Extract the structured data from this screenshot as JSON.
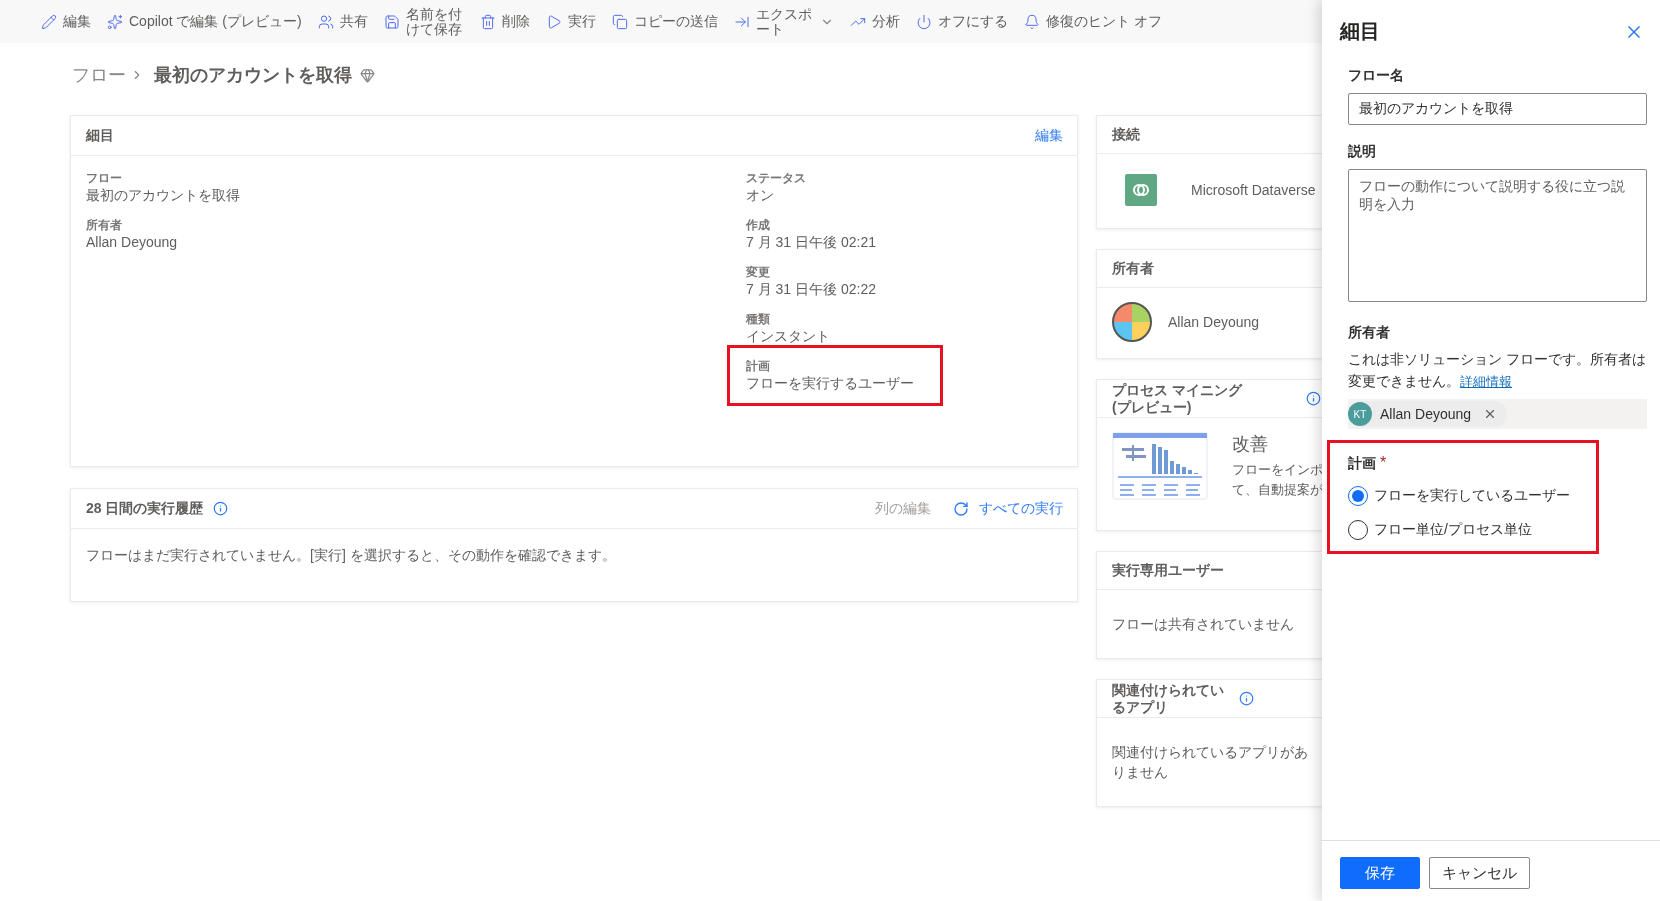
{
  "toolbar": [
    {
      "kind": "edit",
      "label": "編集"
    },
    {
      "kind": "copilot",
      "label": "Copilot で編集 (プレビュー)"
    },
    {
      "kind": "share",
      "label": "共有"
    },
    {
      "kind": "save-as",
      "label": "名前を付けて保存"
    },
    {
      "kind": "delete",
      "label": "削除"
    },
    {
      "kind": "run",
      "label": "実行"
    },
    {
      "kind": "copy",
      "label": "コピーの送信"
    },
    {
      "kind": "export",
      "label": "エクスポート",
      "menu": true
    },
    {
      "kind": "analytics",
      "label": "分析"
    },
    {
      "kind": "power",
      "label": "オフにする"
    },
    {
      "kind": "bell",
      "label": "修復のヒント オフ"
    }
  ],
  "breadcrumb": {
    "parent": "フロー",
    "current": "最初のアカウントを取得"
  },
  "details_card": {
    "title": "細目",
    "edit_link": "編集",
    "left_fields": [
      {
        "label": "フロー",
        "value": "最初のアカウントを取得",
        "highlighted": false
      },
      {
        "label": "所有者",
        "value": "Allan Deyoung",
        "highlighted": false
      }
    ],
    "right_fields": [
      {
        "label": "ステータス",
        "value": "オン",
        "highlighted": false
      },
      {
        "label": "作成",
        "value": "7 月 31 日午後 02:21",
        "highlighted": false
      },
      {
        "label": "変更",
        "value": "7 月 31 日午後 02:22",
        "highlighted": false
      },
      {
        "label": "種類",
        "value": "インスタント",
        "highlighted": false
      },
      {
        "label": "計画",
        "value": "フローを実行するユーザー",
        "highlighted": true
      }
    ]
  },
  "run_history": {
    "title": "28 日間の実行履歴",
    "edit_columns": "列の編集",
    "all_runs": "すべての実行",
    "message": "フローはまだ実行されていません。[実行] を選択すると、その動作を確認できます。"
  },
  "side_cards": [
    {
      "kind": "connection",
      "title": "接続",
      "name": "Microsoft Dataverse"
    },
    {
      "kind": "owner",
      "title": "所有者",
      "name": "Allan Deyoung"
    },
    {
      "kind": "mining",
      "title": "プロセス マイニング (プレビュー)",
      "heading": "改善",
      "lines": [
        "フローをインポ",
        "て、自動提案が"
      ]
    },
    {
      "kind": "message",
      "title": "実行専用ユーザー",
      "message": "フローは共有されていません"
    },
    {
      "kind": "message",
      "title": "関連付けられているアプリ",
      "info": true,
      "message": "関連付けられているアプリがありません"
    }
  ],
  "panel": {
    "title": "細目",
    "flow_name": {
      "label": "フロー名",
      "value": "最初のアカウントを取得"
    },
    "description": {
      "label": "説明",
      "placeholder": "フローの動作について説明する役に立つ説明を入力"
    },
    "owner": {
      "label": "所有者",
      "note": "これは非ソリューション フローです。所有者は変更できません。",
      "link": "詳細情報",
      "chip": {
        "initials": "KT",
        "name": "Allan Deyoung"
      }
    },
    "plan": {
      "label": "計画",
      "required_mark": "*",
      "highlighted": true,
      "options": [
        {
          "label": "フローを実行しているユーザー",
          "selected": true
        },
        {
          "label": "フロー単位/プロセス単位",
          "selected": false
        }
      ]
    },
    "buttons": [
      {
        "kind": "primary",
        "label": "保存"
      },
      {
        "kind": "secondary",
        "label": "キャンセル"
      }
    ]
  }
}
